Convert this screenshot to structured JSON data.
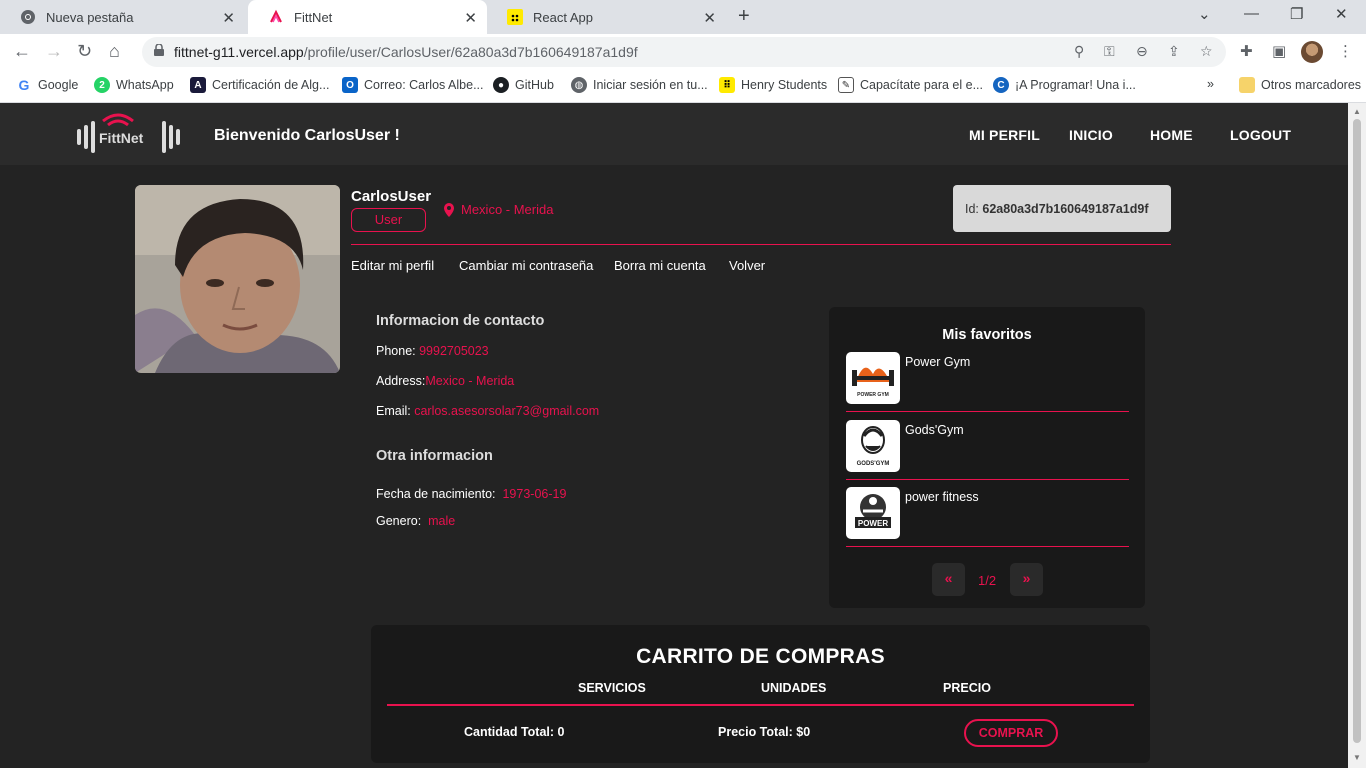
{
  "browser": {
    "tabs": [
      {
        "title": "Nueva pestaña",
        "icon": "chrome-icon",
        "active": false
      },
      {
        "title": "FittNet",
        "icon": "fittnet-icon",
        "active": true
      },
      {
        "title": "React App",
        "icon": "react-app-icon",
        "active": false
      }
    ],
    "url_host": "fittnet-g11.vercel.app",
    "url_path": "/profile/user/CarlosUser/62a80a3d7b160649187a1d9f",
    "bookmarks": [
      {
        "label": "Google",
        "icon": "google-icon"
      },
      {
        "label": "WhatsApp",
        "icon": "whatsapp-icon"
      },
      {
        "label": "Certificación de Alg...",
        "icon": "algorithm-cert-icon"
      },
      {
        "label": "Correo: Carlos Albe...",
        "icon": "outlook-icon"
      },
      {
        "label": "GitHub",
        "icon": "github-icon"
      },
      {
        "label": "Iniciar sesión en tu...",
        "icon": "globe-icon"
      },
      {
        "label": "Henry Students",
        "icon": "henry-icon"
      },
      {
        "label": "Capacítate para el e...",
        "icon": "edit-doc-icon"
      },
      {
        "label": "¡A Programar! Una i...",
        "icon": "c-icon"
      }
    ],
    "other_bookmarks": "Otros marcadores"
  },
  "colors": {
    "accent": "#e8124e",
    "background": "#232323",
    "navbar": "#2b2b2b",
    "card": "#191919"
  },
  "nav": {
    "welcome": "Bienvenido CarlosUser !",
    "links": [
      "MI PERFIL",
      "INICIO",
      "HOME",
      "LOGOUT"
    ]
  },
  "profile": {
    "username": "CarlosUser",
    "role": "User",
    "location": "Mexico - Merida",
    "id_label": "Id:",
    "id_value": "62a80a3d7b160649187a1d9f",
    "actions": [
      "Editar mi perfil",
      "Cambiar mi contraseña",
      "Borra mi cuenta",
      "Volver"
    ]
  },
  "contact": {
    "title": "Informacion de contacto",
    "phone_label": "Phone:",
    "phone": "9992705023",
    "address_label": "Address:",
    "address": "Mexico - Merida",
    "email_label": "Email:",
    "email": "carlos.asesorsolar73@gmail.com"
  },
  "other": {
    "title": "Otra informacion",
    "birth_label": "Fecha de nacimiento:",
    "birth": "1973-06-19",
    "gender_label": "Genero:",
    "gender": "male"
  },
  "favorites": {
    "title": "Mis favoritos",
    "items": [
      {
        "name": "Power Gym",
        "logo_text": "POWER GYM"
      },
      {
        "name": "Gods'Gym",
        "logo_text": "GODS'GYM"
      },
      {
        "name": "power fitness",
        "logo_text": "POWER"
      }
    ],
    "prev": "«",
    "next": "»",
    "page": "1/2"
  },
  "cart": {
    "title": "CARRITO DE COMPRAS",
    "columns": [
      "SERVICIOS",
      "UNIDADES",
      "PRECIO"
    ],
    "total_qty": "Cantidad Total: 0",
    "total_price": "Precio Total: $0",
    "buy": "COMPRAR"
  }
}
